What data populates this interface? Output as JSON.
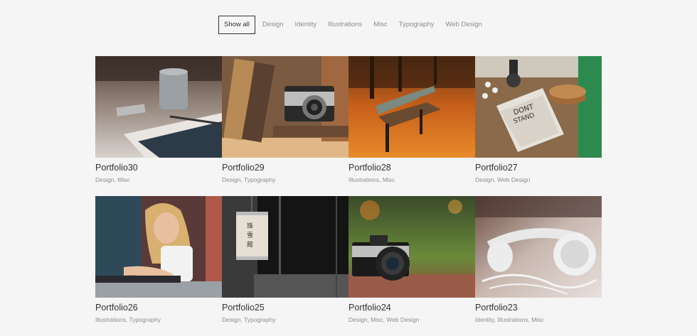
{
  "filters": [
    {
      "label": "Show all",
      "active": true
    },
    {
      "label": "Design",
      "active": false
    },
    {
      "label": "Identity",
      "active": false
    },
    {
      "label": "Illustrations",
      "active": false
    },
    {
      "label": "Misc",
      "active": false
    },
    {
      "label": "Typography",
      "active": false
    },
    {
      "label": "Web Design",
      "active": false
    }
  ],
  "portfolio": [
    {
      "title": "Portfolio30",
      "categories": "Design, Misc",
      "image": "desk-notebook-mug-photo"
    },
    {
      "title": "Portfolio29",
      "categories": "Design, Typography",
      "image": "vintage-camera-books-photo"
    },
    {
      "title": "Portfolio28",
      "categories": "Illustrations, Misc",
      "image": "autumn-park-bench-photo"
    },
    {
      "title": "Portfolio27",
      "categories": "Design, Web Design",
      "image": "dont-just-stand-there-book-photo"
    },
    {
      "title": "Portfolio26",
      "categories": "Illustrations, Typography",
      "image": "woman-reading-phone-photo"
    },
    {
      "title": "Portfolio25",
      "categories": "Design, Typography",
      "image": "paper-lantern-photo"
    },
    {
      "title": "Portfolio24",
      "categories": "Design, Misc, Web Design",
      "image": "slr-camera-photo"
    },
    {
      "title": "Portfolio23",
      "categories": "Identity, Illustrations, Misc",
      "image": "white-headphones-photo"
    }
  ]
}
